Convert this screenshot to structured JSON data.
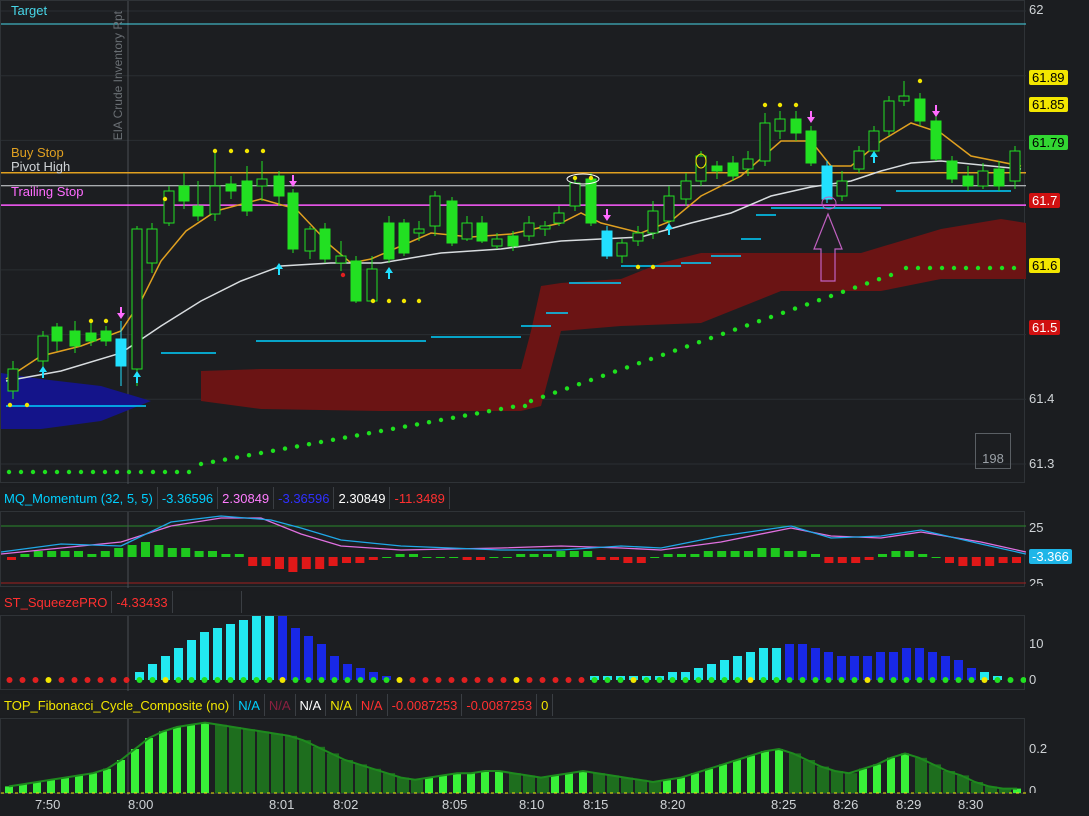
{
  "main_pane": {
    "levels": {
      "target": "Target",
      "buy_stop": "Buy Stop",
      "pivot_high": "Pivot High",
      "trailing_stop": "Trailing Stop"
    },
    "event_label": "EIA Crude Inventory Rpt",
    "price_ticks": [
      "62",
      "61.4",
      "61.3"
    ],
    "price_tags": [
      {
        "label": "61.89",
        "bg": "#f2e600",
        "fg": "#000000"
      },
      {
        "label": "61.85",
        "bg": "#f2e600",
        "fg": "#000000"
      },
      {
        "label": "61.79",
        "bg": "#32d732",
        "fg": "#000000"
      },
      {
        "label": "61.7",
        "bg": "#d01010",
        "fg": "#ffffff"
      },
      {
        "label": "61.6",
        "bg": "#f2e600",
        "fg": "#000000"
      },
      {
        "label": "61.5",
        "bg": "#d01010",
        "fg": "#ffffff"
      }
    ],
    "badge": "198",
    "colors": {
      "up_candle": "#22e022",
      "down_candle": "#22e022",
      "cyan": "#00e5ff",
      "cloud": "#6b1414",
      "cloud_blue": "#14148a",
      "magenta": "#ff5cff",
      "yellow": "#f2e600"
    }
  },
  "momentum_pane": {
    "header": [
      "MQ_Momentum (32, 5, 5)",
      "-3.36596",
      "2.30849",
      "-3.36596",
      "2.30849",
      "-11.3489"
    ],
    "header_colors": [
      "#00d0ff",
      "#ff7cff",
      "#3030ff",
      "#ffffff",
      "#ff3030"
    ],
    "ticks": [
      "25",
      "25"
    ],
    "tag": {
      "label": "-3.366",
      "bg": "#1fb6e8",
      "fg": "#ffffff"
    }
  },
  "squeeze_pane": {
    "header": [
      "ST_SqueezePRO",
      "-4.33433"
    ],
    "ticks": [
      "10",
      "0"
    ]
  },
  "fib_pane": {
    "header": [
      "TOP_Fibonacci_Cycle_Composite (no)",
      "N/A",
      "N/A",
      "N/A",
      "N/A",
      "N/A",
      "-0.0087253",
      "-0.0087253",
      "0"
    ],
    "header_colors": [
      "#f2e600",
      "#00d0ff",
      "#8a2040",
      "#ffffff",
      "#f2e600",
      "#ff3030",
      "#ff3030",
      "#ff3030",
      "#f2e600"
    ],
    "ticks": [
      "0.2",
      "0"
    ]
  },
  "time_axis": [
    "7:50",
    "8:00",
    "8:01",
    "8:02",
    "8:05",
    "8:10",
    "8:15",
    "8:20",
    "8:25",
    "8:26",
    "8:29",
    "8:30"
  ],
  "chart_data": {
    "type": "line",
    "title": "",
    "ylim": [
      61.28,
      62.01
    ],
    "price_levels": {
      "Target": 61.98,
      "Buy Stop": 61.75,
      "Pivot High": 61.73,
      "Trailing Stop": 61.7
    },
    "momentum": [
      -1,
      1,
      2,
      2,
      2,
      2,
      1,
      2,
      3,
      4,
      5,
      4,
      3,
      3,
      2,
      2,
      1,
      1,
      -3,
      -3,
      -4,
      -5,
      -4,
      -4,
      -3,
      -2,
      -2,
      -1,
      0,
      1,
      1,
      0,
      0,
      0,
      -1,
      -1,
      0,
      0,
      1,
      1,
      1,
      2,
      2,
      2,
      -1,
      -1,
      -2,
      -2,
      0,
      1,
      1,
      1,
      2,
      2,
      2,
      2,
      3,
      3,
      2,
      2,
      1,
      -2,
      -2,
      -2,
      -1,
      1,
      2,
      2,
      1,
      0,
      -2,
      -3,
      -3,
      -3,
      -2,
      -2
    ],
    "squeeze": [
      0,
      0,
      0,
      0,
      0,
      0,
      0,
      0,
      0,
      0,
      2,
      4,
      6,
      8,
      10,
      12,
      13,
      14,
      15,
      16,
      17,
      16,
      13,
      11,
      9,
      6,
      4,
      3,
      2,
      1,
      0,
      0,
      0,
      0,
      0,
      0,
      0,
      0,
      0,
      0,
      0,
      0,
      0,
      0,
      0,
      1,
      1,
      1,
      1,
      1,
      1,
      2,
      2,
      3,
      4,
      5,
      6,
      7,
      8,
      8,
      9,
      9,
      8,
      7,
      6,
      6,
      6,
      7,
      7,
      8,
      8,
      7,
      6,
      5,
      3,
      2,
      1,
      0,
      0
    ],
    "fib": [
      0.03,
      0.04,
      0.05,
      0.06,
      0.07,
      0.08,
      0.09,
      0.11,
      0.15,
      0.2,
      0.25,
      0.28,
      0.3,
      0.31,
      0.32,
      0.31,
      0.3,
      0.29,
      0.28,
      0.27,
      0.26,
      0.24,
      0.21,
      0.18,
      0.15,
      0.13,
      0.11,
      0.09,
      0.07,
      0.06,
      0.07,
      0.08,
      0.09,
      0.09,
      0.1,
      0.1,
      0.09,
      0.08,
      0.07,
      0.08,
      0.09,
      0.1,
      0.09,
      0.08,
      0.07,
      0.06,
      0.05,
      0.06,
      0.07,
      0.09,
      0.11,
      0.13,
      0.15,
      0.17,
      0.19,
      0.2,
      0.18,
      0.15,
      0.12,
      0.1,
      0.09,
      0.11,
      0.13,
      0.16,
      0.18,
      0.16,
      0.13,
      0.1,
      0.08,
      0.05,
      0.03,
      0.02,
      0.02
    ]
  }
}
